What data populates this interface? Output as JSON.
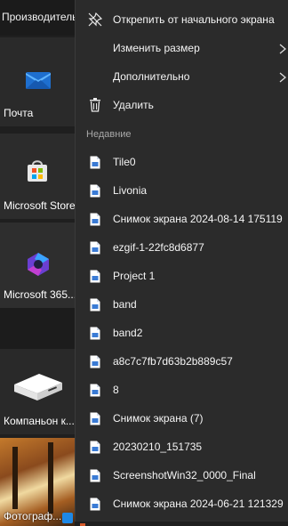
{
  "group_header": "Производительность",
  "tiles": [
    {
      "label": "Почта",
      "icon": "mail-icon"
    },
    {
      "label": "Microsoft Store",
      "icon": "store-icon"
    },
    {
      "label": "Microsoft 365...",
      "icon": "microsoft-365-icon"
    },
    {
      "label": "Компаньон к...",
      "icon": "companion-device-icon"
    },
    {
      "label": "Фотограф...",
      "icon": "photos-icon"
    }
  ],
  "menu": {
    "unpin": {
      "label": "Открепить от начального экрана",
      "icon": "unpin-icon"
    },
    "resize": {
      "label": "Изменить размер",
      "icon": "chevron-right-icon"
    },
    "more": {
      "label": "Дополнительно",
      "icon": "chevron-right-icon"
    },
    "delete": {
      "label": "Удалить",
      "icon": "trash-icon"
    },
    "recent_header": "Недавние",
    "recent": [
      "Tile0",
      "Livonia",
      "Снимок экрана 2024-08-14 175119",
      "ezgif-1-22fc8d6877",
      "Project 1",
      "band",
      "band2",
      "a8c7c7fb7d63b2b889c57",
      "8",
      "Снимок экрана (7)",
      "20230210_151735",
      "ScreenshotWin32_0000_Final",
      "Снимок экрана 2024-06-21 121329"
    ]
  },
  "colors": {
    "menu_bg": "#2b2b2b",
    "tile_bg": "#2b2b2b",
    "mail_blue": "#2f8fe0",
    "doc_blue": "#3a7bd5"
  }
}
